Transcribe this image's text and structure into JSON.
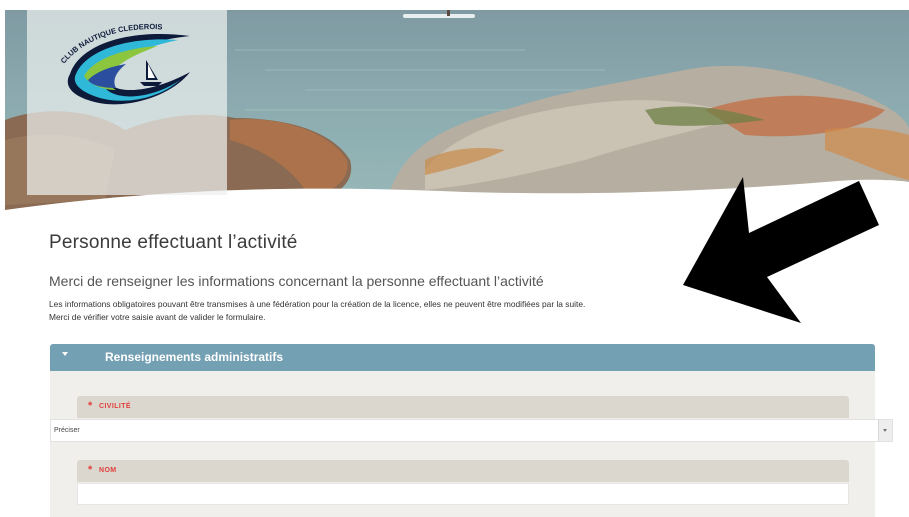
{
  "logo": {
    "text": "CLUB NAUTIQUE CLEDEROIS",
    "colors": {
      "blue": "#2b4f9e",
      "cyan": "#2fb8d8",
      "green": "#8cc63f",
      "outline": "#0d1a3a"
    }
  },
  "page": {
    "title": "Personne effectuant l’activité",
    "subtitle": "Merci de renseigner les informations concernant la personne effectuant l’activité",
    "info_line1": "Les informations obligatoires pouvant être transmises à une fédération pour la création de la licence, elles ne peuvent être modifiées par la suite.",
    "info_line2": "Merci de vérifier votre saisie avant de valider le formulaire."
  },
  "section": {
    "title": "Renseignements administratifs",
    "header_color": "#74a0b3",
    "fields": {
      "civilite": {
        "label": "CIVILITÉ",
        "required_mark": "*",
        "value": "Préciser"
      },
      "nom": {
        "label": "NOM",
        "required_mark": "*",
        "value": ""
      }
    }
  },
  "colors": {
    "required": "#e0403c",
    "label_bar": "#dcd7ce",
    "section_bg": "#f1efeb"
  },
  "annotation": {
    "icon": "arrow-icon",
    "color": "#000000"
  }
}
